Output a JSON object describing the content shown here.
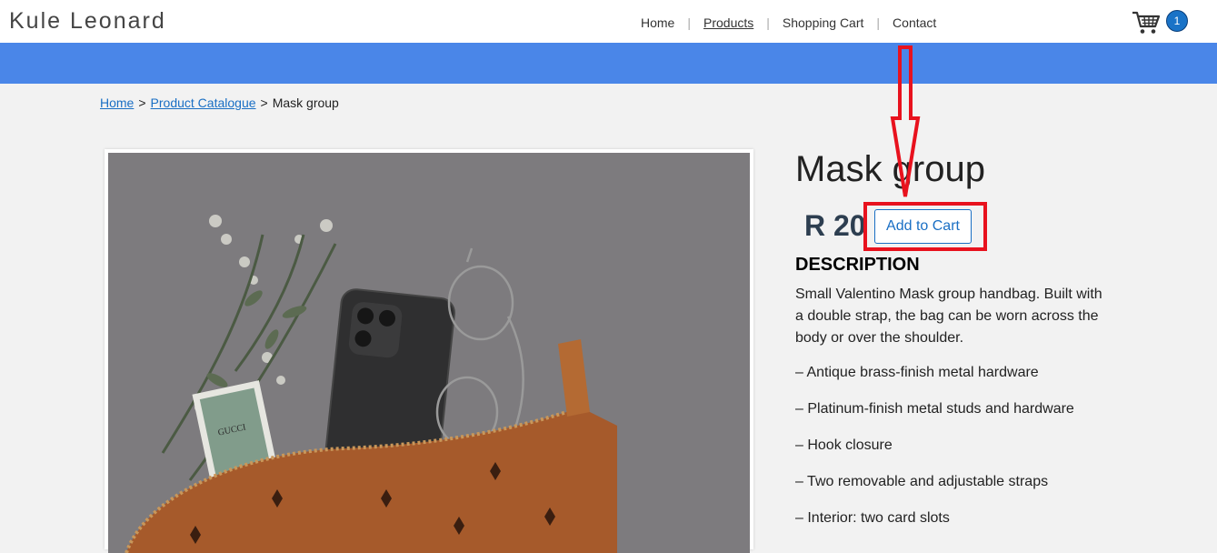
{
  "header": {
    "brand": "Kule Leonard",
    "nav": [
      "Home",
      "Products",
      "Shopping Cart",
      "Contact"
    ],
    "nav_separator": "|",
    "cart_count": "1"
  },
  "breadcrumb": {
    "home": "Home",
    "catalogue": "Product Catalogue",
    "current": "Mask group",
    "separator": ">"
  },
  "product": {
    "title": "Mask group",
    "price": "R 20",
    "add_to_cart": "Add to Cart",
    "description_heading": "DESCRIPTION",
    "description": "Small Valentino Mask group handbag. Built with a double strap, the bag can be worn across the body or over the shoulder.",
    "features": [
      "– Antique brass-finish metal hardware",
      "– Platinum-finish metal studs and hardware",
      "– Hook closure",
      "– Two removable and adjustable straps",
      "– Interior: two card slots"
    ]
  },
  "colors": {
    "band": "#4a86e8",
    "link": "#1a6fc4",
    "annotation": "#e8121e",
    "badge": "#1a73c7"
  }
}
